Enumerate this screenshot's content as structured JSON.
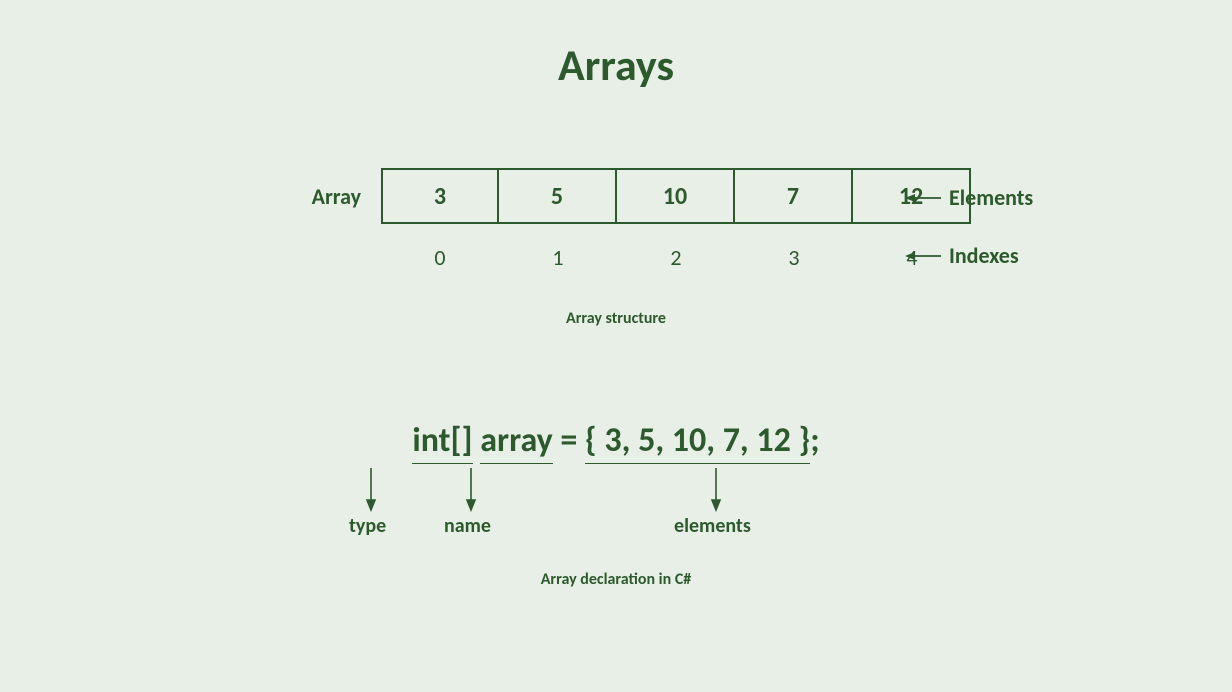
{
  "title": "Arrays",
  "array_label": "Array",
  "elements": [
    "3",
    "5",
    "10",
    "7",
    "12"
  ],
  "indexes": [
    "0",
    "1",
    "2",
    "3",
    "4"
  ],
  "right_labels": {
    "elements": "Elements",
    "indexes": "Indexes"
  },
  "caption1": "Array structure",
  "declaration": {
    "type_part": "int[]",
    "name_part": "array",
    "equals": " = ",
    "elements_part": "{ 3, 5, 10, 7, 12 }",
    "terminator": ";"
  },
  "annotations": {
    "type": "type",
    "name": "name",
    "elements": "elements"
  },
  "caption2": "Array declaration in C#"
}
